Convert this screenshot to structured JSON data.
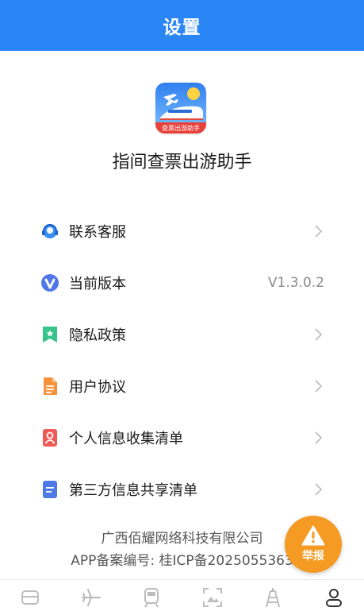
{
  "header": {
    "title": "设置"
  },
  "app": {
    "icon_caption": "查票出游助手",
    "name": "指间查票出游助手"
  },
  "menu": {
    "items": [
      {
        "label": "联系客服",
        "icon": "customer-service-icon",
        "value": ""
      },
      {
        "label": "当前版本",
        "icon": "version-icon",
        "value": "V1.3.0.2"
      },
      {
        "label": "隐私政策",
        "icon": "privacy-icon",
        "value": ""
      },
      {
        "label": "用户协议",
        "icon": "agreement-icon",
        "value": ""
      },
      {
        "label": "个人信息收集清单",
        "icon": "personal-info-icon",
        "value": ""
      },
      {
        "label": "第三方信息共享清单",
        "icon": "third-party-icon",
        "value": ""
      }
    ]
  },
  "footer": {
    "company": "广西佰耀网络科技有限公司",
    "icp": "APP备案编号: 桂ICP备2025055363"
  },
  "report_button": {
    "label": "举报",
    "color": "#f59a23"
  },
  "tabbar": {
    "tabs": [
      {
        "icon": "ticket-icon",
        "active": false
      },
      {
        "icon": "plane-icon",
        "active": false
      },
      {
        "icon": "train-icon",
        "active": false
      },
      {
        "icon": "scenery-icon",
        "active": false
      },
      {
        "icon": "tower-icon",
        "active": false
      },
      {
        "icon": "user-icon",
        "active": true
      }
    ]
  },
  "colors": {
    "primary": "#2b86f5",
    "report": "#f59a23"
  }
}
